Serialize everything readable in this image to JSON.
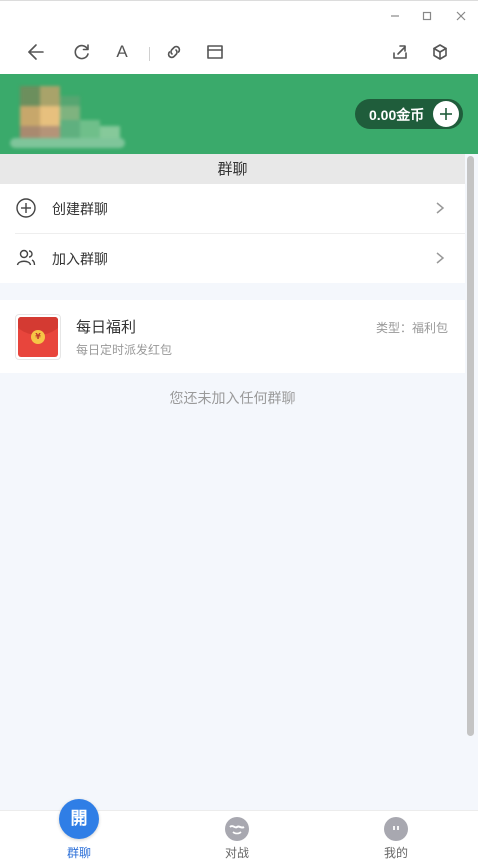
{
  "window": {
    "buttons": [
      {
        "name": "minimize",
        "icon": "minimize-icon"
      },
      {
        "name": "maximize",
        "icon": "maximize-icon"
      },
      {
        "name": "close",
        "icon": "close-icon"
      }
    ]
  },
  "toolbar": {
    "font_label": "A"
  },
  "header": {
    "coins": "0.00金币",
    "accent_color": "#3aaa6b"
  },
  "section": {
    "title": "群聊"
  },
  "menu": {
    "items": [
      {
        "label": "创建群聊",
        "icon": "plus-circle-icon"
      },
      {
        "label": "加入群聊",
        "icon": "users-icon"
      }
    ]
  },
  "card": {
    "title": "每日福利",
    "subtitle": "每日定时派发红包",
    "type": "类型：福利包",
    "icon_symbol": "¥"
  },
  "empty": {
    "message": "您还未加入任何群聊"
  },
  "tabs": [
    {
      "label": "群聊",
      "icon_text": "開",
      "active": true
    },
    {
      "label": "对战",
      "active": false
    },
    {
      "label": "我的",
      "active": false
    }
  ],
  "colors": {
    "tab_active": "#2b6fd8",
    "pill": "#1f5d3b"
  }
}
